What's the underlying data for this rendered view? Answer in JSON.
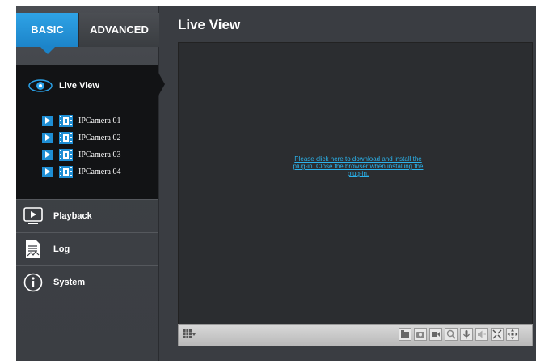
{
  "tabs": {
    "basic": "BASIC",
    "advanced": "ADVANCED"
  },
  "sidebar": {
    "live_view": "Live View",
    "cameras": [
      "IPCamera 01",
      "IPCamera 02",
      "IPCamera 03",
      "IPCamera 04"
    ],
    "menu": [
      {
        "label": "Playback",
        "icon": "playback-icon"
      },
      {
        "label": "Log",
        "icon": "log-icon"
      },
      {
        "label": "System",
        "icon": "info-icon"
      }
    ]
  },
  "main": {
    "title": "Live View",
    "plugin_message": "Please click here to download and install the plug-in. Close the browser when installing the plug-in."
  },
  "toolbar": {
    "icons": [
      "layout-icon",
      "snapshot-folder-icon",
      "snapshot-icon",
      "record-icon",
      "zoom-icon",
      "microphone-icon",
      "speaker-icon",
      "fullscreen-exit-icon",
      "ptz-icon"
    ]
  },
  "colors": {
    "accent": "#1e8ed4",
    "link": "#2bb4ee",
    "background": "#3a3d42"
  }
}
